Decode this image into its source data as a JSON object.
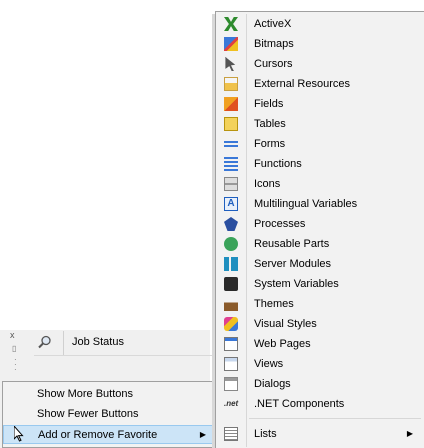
{
  "background": {
    "job_row": {
      "label": "Job Status",
      "icon": "magnifier-icon"
    },
    "strip_close_glyph": "x"
  },
  "context_menu": {
    "items": [
      {
        "label": "Show More Buttons"
      },
      {
        "label": "Show Fewer Buttons"
      },
      {
        "label": "Add or Remove Favorite",
        "highlighted": true,
        "submenu_arrow": "▶"
      }
    ]
  },
  "menu": {
    "items": [
      {
        "label": "ActiveX",
        "icon": "activex-icon"
      },
      {
        "label": "Bitmaps",
        "icon": "bitmaps-icon"
      },
      {
        "label": "Cursors",
        "icon": "cursor-icon"
      },
      {
        "label": "External Resources",
        "icon": "external-resources-icon"
      },
      {
        "label": "Fields",
        "icon": "fields-icon"
      },
      {
        "label": "Tables",
        "icon": "tables-icon"
      },
      {
        "label": "Forms",
        "icon": "forms-icon"
      },
      {
        "label": "Functions",
        "icon": "functions-icon"
      },
      {
        "label": "Icons",
        "icon": "icons-icon"
      },
      {
        "label": "Multilingual Variables",
        "icon": "multilingual-icon"
      },
      {
        "label": "Processes",
        "icon": "processes-icon"
      },
      {
        "label": "Reusable Parts",
        "icon": "reusable-parts-icon"
      },
      {
        "label": "Server Modules",
        "icon": "server-modules-icon"
      },
      {
        "label": "System Variables",
        "icon": "system-variables-icon"
      },
      {
        "label": "Themes",
        "icon": "themes-icon"
      },
      {
        "label": "Visual Styles",
        "icon": "visual-styles-icon"
      },
      {
        "label": "Web Pages",
        "icon": "web-pages-icon"
      },
      {
        "label": "Views",
        "icon": "views-icon"
      },
      {
        "label": "Dialogs",
        "icon": "dialogs-icon"
      },
      {
        "label": ".NET Components",
        "icon": "net-components-icon",
        "icon_text": ".net"
      }
    ],
    "lists_item": {
      "label": "Lists",
      "icon": "lists-icon",
      "submenu_arrow": "▶"
    }
  },
  "colors": {
    "menu_bg": "#f2f2f2",
    "highlight": "#cce4f7",
    "highlight_border": "#99c9ef",
    "border": "#a0a0a0"
  }
}
